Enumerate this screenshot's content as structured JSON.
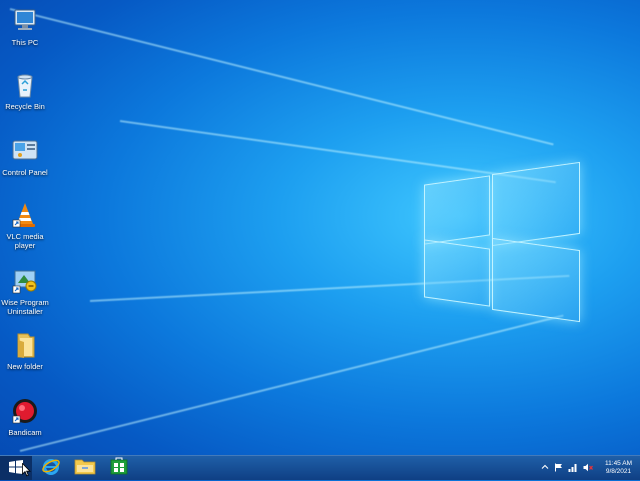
{
  "desktop": {
    "icons": [
      {
        "label": "This PC",
        "icon": "computer-icon"
      },
      {
        "label": "Recycle Bin",
        "icon": "recycle-bin-icon"
      },
      {
        "label": "Control Panel",
        "icon": "control-panel-icon"
      },
      {
        "label": "VLC media player",
        "icon": "vlc-cone-icon"
      },
      {
        "label": "Wise Program Uninstaller",
        "icon": "uninstaller-icon"
      },
      {
        "label": "New folder",
        "icon": "folder-icon"
      },
      {
        "label": "Bandicam",
        "icon": "bandicam-icon"
      }
    ]
  },
  "taskbar": {
    "start_icon": "windows-start-icon",
    "pinned": [
      {
        "name": "Internet Explorer",
        "icon": "internet-explorer-icon"
      },
      {
        "name": "File Explorer",
        "icon": "file-explorer-icon"
      },
      {
        "name": "Store",
        "icon": "store-icon"
      }
    ],
    "tray": {
      "icons": [
        "chevron-up-icon",
        "flag-icon",
        "network-icon",
        "volume-muted-icon"
      ],
      "time": "11:45 AM",
      "date": "9/8/2021"
    }
  },
  "colors": {
    "accent": "#0a6fd8",
    "taskbar": "#123f80"
  }
}
